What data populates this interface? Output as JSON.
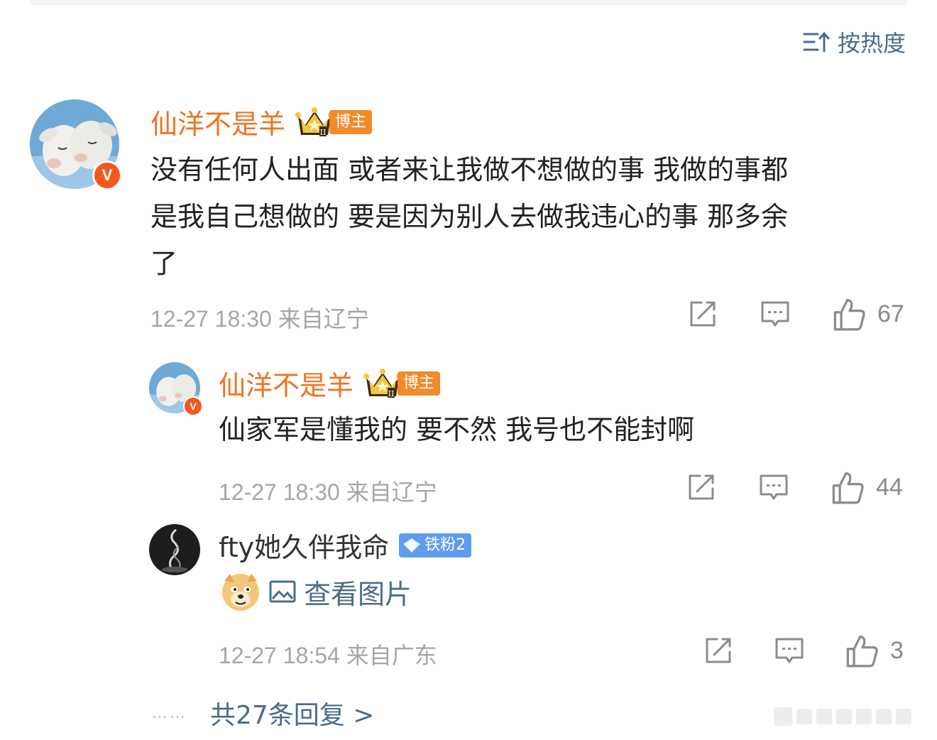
{
  "sort": {
    "label": "按热度",
    "icon": "sort-hot-icon"
  },
  "main_comment": {
    "user": "仙洋不是羊",
    "badge": "博主",
    "verified_mark": "V",
    "text_lines": [
      "没有任何人出面 或者来让我做不想做的事 我做的事都",
      "是我自己想做的 要是因为别人去做我违心的事 那多余",
      "了"
    ],
    "time": "12-27 18:30 来自辽宁",
    "likes": "67"
  },
  "replies": [
    {
      "user": "仙洋不是羊",
      "badge": "博主",
      "verified_mark": "V",
      "text": "仙家军是懂我的 要不然 我号也不能封啊",
      "time": "12-27 18:30 来自辽宁",
      "likes": "44"
    },
    {
      "user": "fty她久伴我命",
      "badge": "铁粉2",
      "image_link": "查看图片",
      "time": "12-27 18:54 来自广东",
      "likes": "3"
    }
  ],
  "more_replies": {
    "dots": "……",
    "label": "共27条回复 >"
  },
  "colors": {
    "accent_link": "#4a6c8c",
    "username": "#f0731f",
    "meta": "#a6a6a6"
  }
}
